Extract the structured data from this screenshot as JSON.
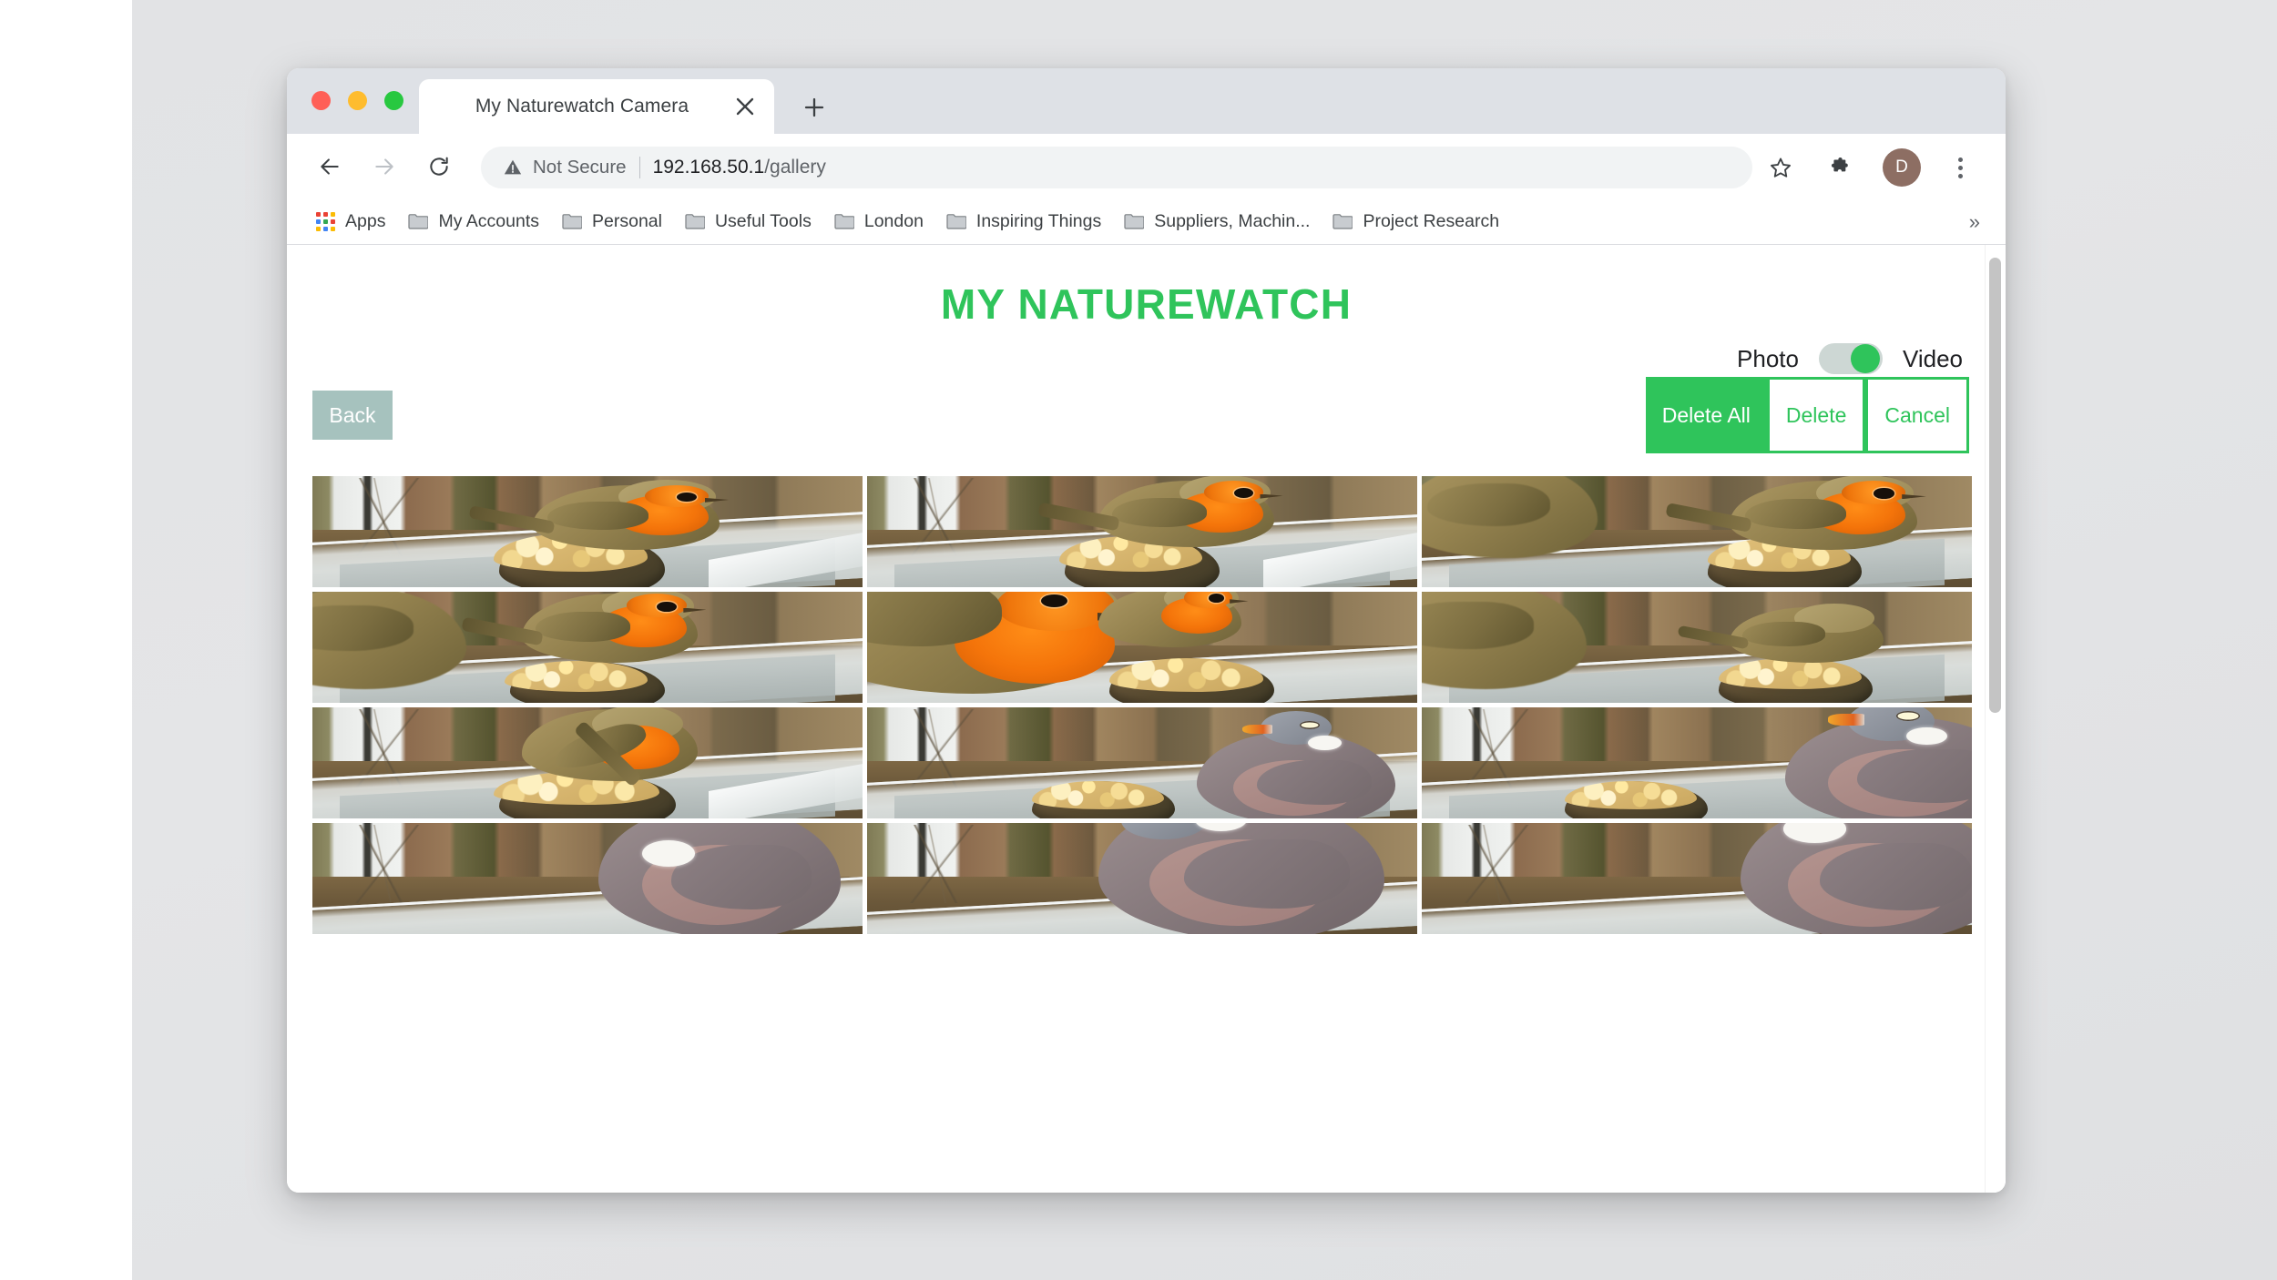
{
  "browser": {
    "tab": {
      "title": "My Naturewatch Camera",
      "close_icon": "close-icon"
    },
    "new_tab_icon": "plus-icon",
    "traffic_lights": [
      "close",
      "minimize",
      "zoom"
    ],
    "nav": {
      "back_icon": "arrow-left-icon",
      "forward_icon": "arrow-right-icon",
      "reload_icon": "reload-icon"
    },
    "omnibox": {
      "security_icon": "warning-triangle-icon",
      "security_label": "Not Secure",
      "url_host": "192.168.50.1",
      "url_path": "/gallery"
    },
    "actions": {
      "bookmark_icon": "star-icon",
      "extensions_icon": "puzzle-piece-icon",
      "avatar_initial": "D",
      "menu_icon": "three-dot-menu-icon"
    },
    "bookmarks": {
      "apps_label": "Apps",
      "apps_icon": "apps-grid-icon",
      "items": [
        {
          "label": "My Accounts",
          "icon": "folder-icon"
        },
        {
          "label": "Personal",
          "icon": "folder-icon"
        },
        {
          "label": "Useful Tools",
          "icon": "folder-icon"
        },
        {
          "label": "London",
          "icon": "folder-icon"
        },
        {
          "label": "Inspiring Things",
          "icon": "folder-icon"
        },
        {
          "label": "Suppliers, Machin...",
          "icon": "folder-icon"
        },
        {
          "label": "Project Research",
          "icon": "folder-icon"
        }
      ],
      "overflow_label": "»"
    }
  },
  "page": {
    "title": "MY NATUREWATCH",
    "title_color": "#2fc45b",
    "mode_toggle": {
      "left_label": "Photo",
      "right_label": "Video",
      "selected": "Video",
      "knob_color": "#2fc45b",
      "track_color": "#cdd7d4"
    },
    "back_button": {
      "label": "Back",
      "color": "#a6c2be"
    },
    "action_buttons": [
      {
        "label": "Delete All",
        "style": "solid",
        "name": "delete-all-button"
      },
      {
        "label": "Delete",
        "style": "ghost",
        "name": "delete-button"
      },
      {
        "label": "Cancel",
        "style": "ghost",
        "name": "cancel-button"
      }
    ],
    "accent_color": "#2fc45b",
    "gallery": {
      "columns": 3,
      "items": [
        {
          "subject": "robin",
          "pose": "perched-right-facing-left",
          "row": 1,
          "col": 1
        },
        {
          "subject": "robin",
          "pose": "perched-upright",
          "row": 1,
          "col": 2
        },
        {
          "subject": "robin",
          "pose": "two-birds-wing-blur",
          "row": 1,
          "col": 3
        },
        {
          "subject": "robin",
          "pose": "wing-blur-left",
          "row": 2,
          "col": 1
        },
        {
          "subject": "robin",
          "pose": "close-up-feeding-seed",
          "row": 2,
          "col": 2
        },
        {
          "subject": "robin",
          "pose": "wing-blur-back-turned",
          "row": 2,
          "col": 3
        },
        {
          "subject": "robin",
          "pose": "tail-up-feeding",
          "row": 3,
          "col": 1
        },
        {
          "subject": "pigeon",
          "pose": "wood-pigeon-standing",
          "row": 3,
          "col": 2
        },
        {
          "subject": "pigeon",
          "pose": "wood-pigeon-close",
          "row": 3,
          "col": 3
        },
        {
          "subject": "pigeon",
          "pose": "wood-pigeon-partial",
          "row": 4,
          "col": 1
        },
        {
          "subject": "pigeon",
          "pose": "wood-pigeon-head-partial",
          "row": 4,
          "col": 2
        },
        {
          "subject": "pigeon",
          "pose": "wood-pigeon-neck-partial",
          "row": 4,
          "col": 3
        }
      ]
    }
  }
}
